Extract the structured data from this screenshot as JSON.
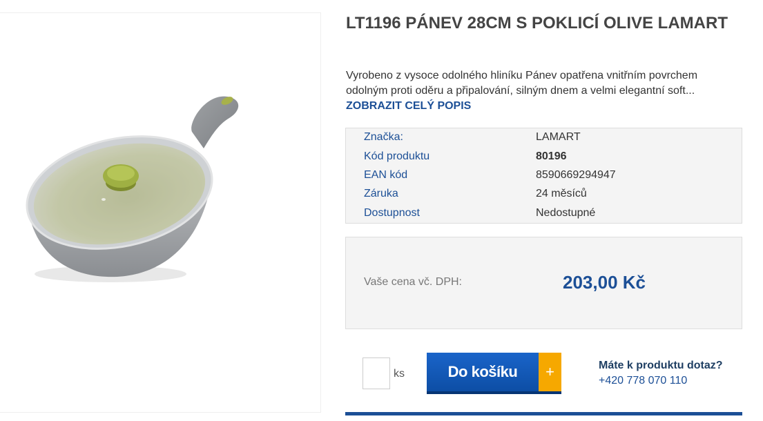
{
  "product": {
    "title": "LT1196 PÁNEV 28CM S POKLICÍ OLIVE LAMART",
    "description": "Vyrobeno z vysoce odolného hliníku Pánev opatřena vnitřním povrchem odolným proti oděru a připalování, silným dnem a velmi elegantní soft...",
    "full_description_link": "ZOBRAZIT CELÝ POPIS",
    "image_icon": "frying-pan-with-lid"
  },
  "params": [
    {
      "label": "Značka:",
      "value": "LAMART"
    },
    {
      "label": "Kód produktu",
      "value": "80196"
    },
    {
      "label": "EAN kód",
      "value": "8590669294947"
    },
    {
      "label": "Záruka",
      "value": "24 měsíců"
    },
    {
      "label": "Dostupnost",
      "value": "Nedostupné"
    }
  ],
  "price": {
    "label": "Vaše cena vč. DPH:",
    "value": "203,00 Kč"
  },
  "cart": {
    "quantity": "",
    "unit": "ks",
    "button_label": "Do košíku",
    "plus_symbol": "+"
  },
  "contact": {
    "question": "Máte k produktu dotaz?",
    "phone": "+420 778 070 110"
  },
  "colors": {
    "accent": "#1c4f96",
    "button": "#1a64c9",
    "button_plus": "#f6a800"
  }
}
